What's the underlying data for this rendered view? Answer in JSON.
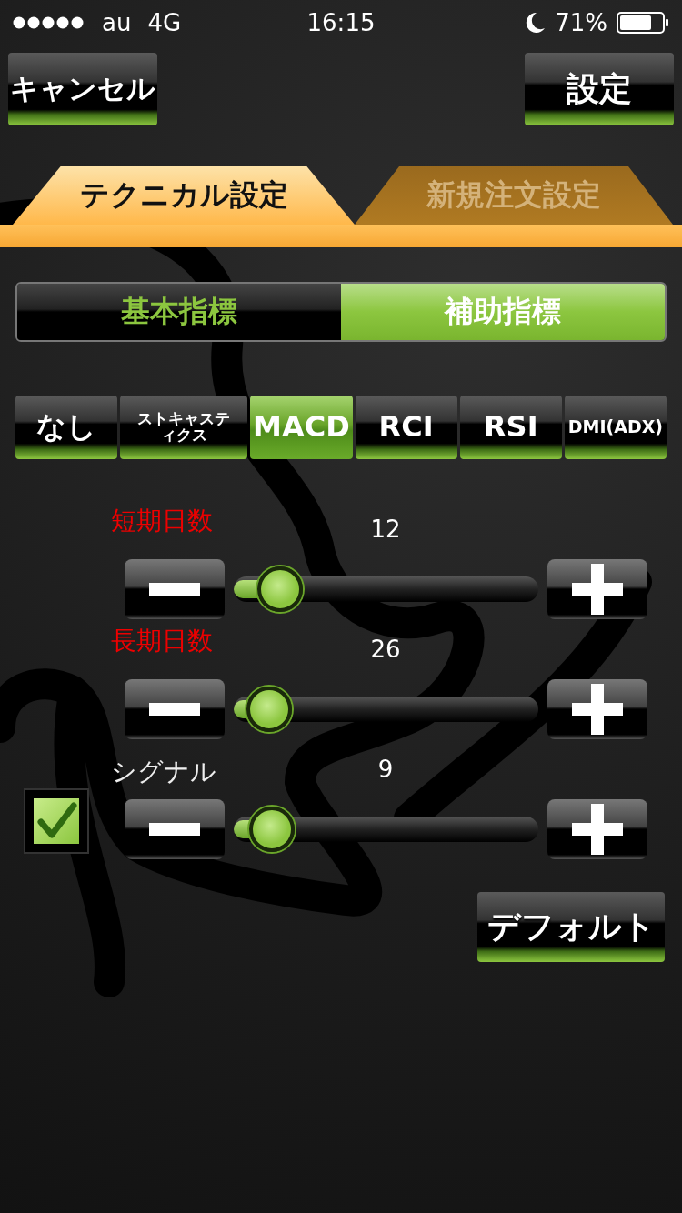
{
  "status_bar": {
    "carrier": "au",
    "network": "4G",
    "time": "16:15",
    "battery": "71%"
  },
  "header": {
    "cancel_button": "キャンセル",
    "set_button": "設定"
  },
  "tabs": [
    {
      "label": "テクニカル設定",
      "selected": true
    },
    {
      "label": "新規注文設定",
      "selected": false
    }
  ],
  "segments": [
    {
      "label": "基本指標",
      "selected": false
    },
    {
      "label": "補助指標",
      "selected": true
    }
  ],
  "indicators": [
    {
      "label": "なし",
      "selected": false
    },
    {
      "label": "ストキャスティクス",
      "selected": false
    },
    {
      "label": "MACD",
      "selected": true
    },
    {
      "label": "RCI",
      "selected": false
    },
    {
      "label": "RSI",
      "selected": false
    },
    {
      "label": "DMI(ADX)",
      "selected": false
    }
  ],
  "params": [
    {
      "kind": "plain",
      "label": "短期日数",
      "value": "12",
      "level": 0.09
    },
    {
      "kind": "plain",
      "label": "長期日数",
      "value": "26",
      "level": 0.05
    },
    {
      "kind": "checkbox",
      "checked": true,
      "label": "シグナル",
      "value": "9",
      "level": 0.06
    }
  ],
  "default_button": "デフォルト"
}
